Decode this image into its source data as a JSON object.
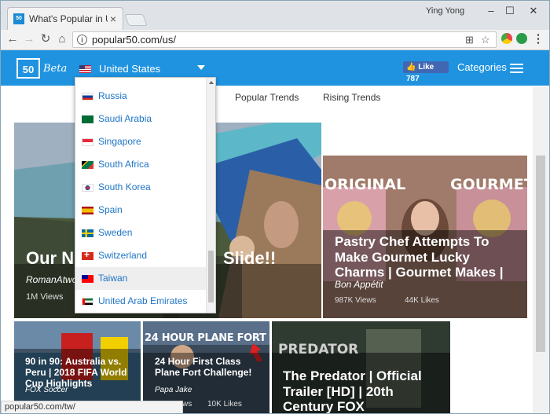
{
  "browser": {
    "tab_title": "What's Popular in Unite",
    "profile_name": "Ying Yong",
    "url": "popular50.com/us/",
    "status_url": "popular50.com/tw/"
  },
  "site": {
    "logo_text": "50",
    "beta_label": "Beta",
    "selected_country": "United States",
    "like_label": "Like 787",
    "categories_label": "Categories",
    "accent_color": "#1f93e0"
  },
  "subnav": {
    "popular_trends": "Popular Trends",
    "rising_trends": "Rising Trends"
  },
  "dropdown": {
    "countries": [
      {
        "name": "Russia",
        "flag": "flag-ru"
      },
      {
        "name": "Saudi Arabia",
        "flag": "flag-sa"
      },
      {
        "name": "Singapore",
        "flag": "flag-sg"
      },
      {
        "name": "South Africa",
        "flag": "flag-za"
      },
      {
        "name": "South Korea",
        "flag": "flag-kr"
      },
      {
        "name": "Spain",
        "flag": "flag-es"
      },
      {
        "name": "Sweden",
        "flag": "flag-se"
      },
      {
        "name": "Switzerland",
        "flag": "flag-ch"
      },
      {
        "name": "Taiwan",
        "flag": "flag-tw",
        "hover": true
      },
      {
        "name": "United Arab Emirates",
        "flag": "flag-ae"
      }
    ]
  },
  "cards": {
    "big": {
      "title_left": "Our N",
      "title_right": "Slide!!",
      "channel": "RomanAtwo",
      "views": "1M Views"
    },
    "pastry": {
      "banner_left": "ORIGINAL",
      "banner_right": "GOURMET",
      "title": "Pastry Chef Attempts To Make Gourmet Lucky Charms | Gourmet Makes |",
      "channel": "Bon Appétit",
      "views": "987K Views",
      "likes": "44K Likes"
    },
    "soccer": {
      "title": "90 in 90: Australia vs. Peru | 2018 FIFA World Cup Highlights",
      "channel": "FOX Soccer"
    },
    "plane": {
      "banner": "24 HOUR PLANE FORT",
      "title": "24 Hour First Class Plane Fort Challenge!",
      "channel": "Papa Jake",
      "views": "ws",
      "likes": "10K Likes"
    },
    "predator": {
      "banner": "PREDATOR",
      "title": "The Predator | Official Trailer [HD] | 20th Century FOX"
    }
  }
}
